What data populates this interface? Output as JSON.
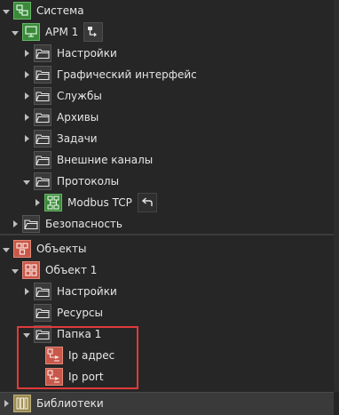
{
  "system_tree": {
    "root": "Система",
    "arm": "АРМ 1",
    "items": {
      "settings": "Настройки",
      "gui": "Графический интерфейс",
      "services": "Службы",
      "archives": "Архивы",
      "tasks": "Задачи",
      "external": "Внешние каналы",
      "protocols": "Протоколы",
      "modbus": "Modbus TCP",
      "security": "Безопасность"
    }
  },
  "objects_tree": {
    "root": "Объекты",
    "object1": "Объект 1",
    "settings": "Настройки",
    "resources": "Ресурсы",
    "folder1": "Папка 1",
    "ip_address": "Ip адрес",
    "ip_port": "Ip port"
  },
  "libraries": {
    "label": "Библиотеки"
  },
  "colors": {
    "green_icon": "#3a8a3a",
    "red_icon": "#c8584a",
    "highlight": "#e03a3a",
    "library_icon": "#9a8a52"
  }
}
